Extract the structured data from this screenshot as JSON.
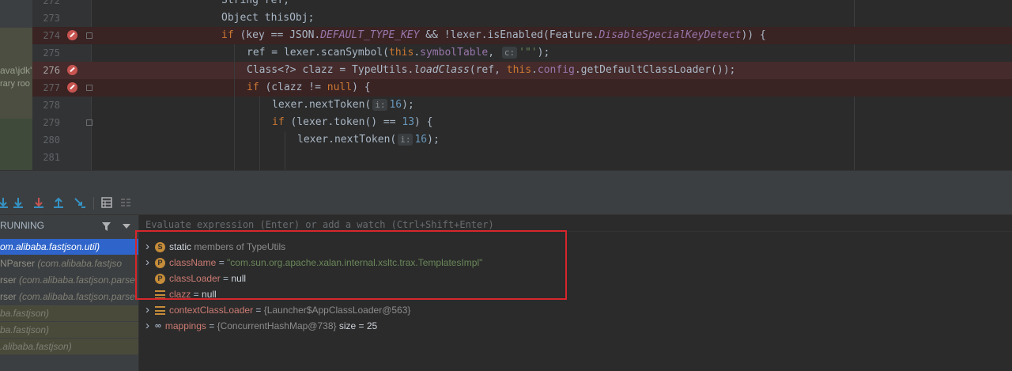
{
  "editor": {
    "project_panel": {
      "path_fragment": "ava\\jdk'",
      "library_fragment": "rary roo"
    },
    "lines": [
      {
        "no": "272",
        "tokens": [
          {
            "t": "String ref;",
            "c": "p"
          }
        ]
      },
      {
        "no": "273",
        "tokens": [
          {
            "t": "Object thisObj;",
            "c": "p"
          }
        ]
      },
      {
        "no": "274",
        "breakpoint": true,
        "fold": true,
        "tokens": [
          {
            "t": "if",
            "c": "kw"
          },
          {
            "t": " (key == JSON.",
            "c": "p"
          },
          {
            "t": "DEFAULT_TYPE_KEY",
            "c": "it"
          },
          {
            "t": " && !lexer.isEnabled(Feature.",
            "c": "p"
          },
          {
            "t": "DisableSpecialKeyDetect",
            "c": "it"
          },
          {
            "t": ")) {",
            "c": "p"
          }
        ]
      },
      {
        "no": "275",
        "tokens": [
          {
            "t": "ref = lexer.scanSymbol(",
            "c": "p"
          },
          {
            "t": "this",
            "c": "kw"
          },
          {
            "t": ".",
            "c": "p"
          },
          {
            "t": "symbolTable",
            "c": "fld"
          },
          {
            "t": ", ",
            "c": "p"
          },
          {
            "t": "c:",
            "c": "hint"
          },
          {
            "t": "'\"'",
            "c": "str"
          },
          {
            "t": ");",
            "c": "p"
          }
        ]
      },
      {
        "no": "276",
        "breakpoint": true,
        "active": true,
        "tokens": [
          {
            "t": "Class<?> clazz = TypeUtils.",
            "c": "p"
          },
          {
            "t": "loadClass",
            "c": "itp"
          },
          {
            "t": "(ref, ",
            "c": "p"
          },
          {
            "t": "this",
            "c": "kw"
          },
          {
            "t": ".",
            "c": "p"
          },
          {
            "t": "config",
            "c": "fld"
          },
          {
            "t": ".getDefaultClassLoader());",
            "c": "p"
          }
        ]
      },
      {
        "no": "277",
        "breakpoint": true,
        "fold": true,
        "tokens": [
          {
            "t": "if",
            "c": "kw"
          },
          {
            "t": " (clazz != ",
            "c": "p"
          },
          {
            "t": "null",
            "c": "kw"
          },
          {
            "t": ") {",
            "c": "p"
          }
        ]
      },
      {
        "no": "278",
        "tokens": [
          {
            "t": "lexer.nextToken(",
            "c": "p"
          },
          {
            "t": "i:",
            "c": "hint"
          },
          {
            "t": "16",
            "c": "num"
          },
          {
            "t": ");",
            "c": "p"
          }
        ]
      },
      {
        "no": "279",
        "fold": true,
        "tokens": [
          {
            "t": "if",
            "c": "kw"
          },
          {
            "t": " (lexer.token() == ",
            "c": "p"
          },
          {
            "t": "13",
            "c": "num"
          },
          {
            "t": ") {",
            "c": "p"
          }
        ]
      },
      {
        "no": "280",
        "tokens": [
          {
            "t": "lexer.nextToken(",
            "c": "p"
          },
          {
            "t": "i:",
            "c": "hint"
          },
          {
            "t": "16",
            "c": "num"
          },
          {
            "t": ");",
            "c": "p"
          }
        ]
      },
      {
        "no": "281",
        "tokens": []
      }
    ]
  },
  "debugger": {
    "frames_header": "RUNNING",
    "frames": [
      {
        "method": "om.alibaba.fastjson.util)",
        "pkg": "",
        "selected": true
      },
      {
        "method": "NParser ",
        "pkg": "(com.alibaba.fastjso",
        "selected": false
      },
      {
        "method": "rser ",
        "pkg": "(com.alibaba.fastjson.parse",
        "selected": false
      },
      {
        "method": "rser ",
        "pkg": "(com.alibaba.fastjson.parse",
        "selected": false
      },
      {
        "method": "",
        "pkg": "ba.fastjson)",
        "selected": false
      },
      {
        "method": "",
        "pkg": "ba.fastjson)",
        "selected": false
      },
      {
        "method": "",
        "pkg": ".alibaba.fastjson)",
        "selected": false
      }
    ],
    "evaluate_placeholder": "Evaluate expression (Enter) or add a watch (Ctrl+Shift+Enter)",
    "variables": [
      {
        "expand": true,
        "icon": "S",
        "name": "static",
        "suffix": " members of TypeUtils",
        "kind": "static"
      },
      {
        "expand": true,
        "icon": "P",
        "name": "className",
        "op": " = ",
        "value": "\"com.sun.org.apache.xalan.internal.xsltc.trax.TemplatesImpl\"",
        "kind": "string"
      },
      {
        "expand": false,
        "icon": "P",
        "name": "classLoader",
        "op": " = ",
        "value": "null",
        "kind": "plain"
      },
      {
        "expand": false,
        "icon": "field",
        "name": "clazz",
        "op": " = ",
        "value": "null",
        "kind": "plain"
      },
      {
        "expand": true,
        "icon": "field",
        "name": "contextClassLoader",
        "op": " = ",
        "value": "{Launcher$AppClassLoader@563}",
        "kind": "object"
      },
      {
        "expand": true,
        "icon": "watch",
        "name": "mappings",
        "op": " = ",
        "value": "{ConcurrentHashMap@738}",
        "extra": "  size = 25",
        "kind": "object"
      }
    ]
  },
  "colors": {
    "breakpoint": "#c75450",
    "selection": "#2f65ca",
    "highlight_box": "#d7262b",
    "string": "#6a8759",
    "keyword": "#cc7832"
  }
}
